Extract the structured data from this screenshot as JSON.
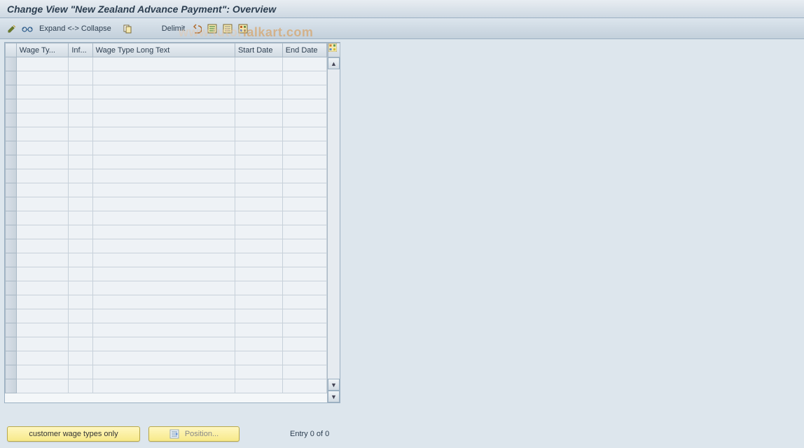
{
  "title": "Change View \"New Zealand Advance Payment\": Overview",
  "toolbar": {
    "expand_label": "Expand <-> Collapse",
    "delimit_label": "Delimit"
  },
  "table": {
    "headers": {
      "wage_type": "Wage Ty...",
      "inf": "Inf...",
      "wage_long": "Wage Type Long Text",
      "start_date": "Start Date",
      "end_date": "End Date"
    }
  },
  "bottom": {
    "customer_btn": "customer wage types only",
    "position_btn": "Position...",
    "entry_text": "Entry 0 of 0"
  },
  "watermark": "www.tutorialkart.com"
}
